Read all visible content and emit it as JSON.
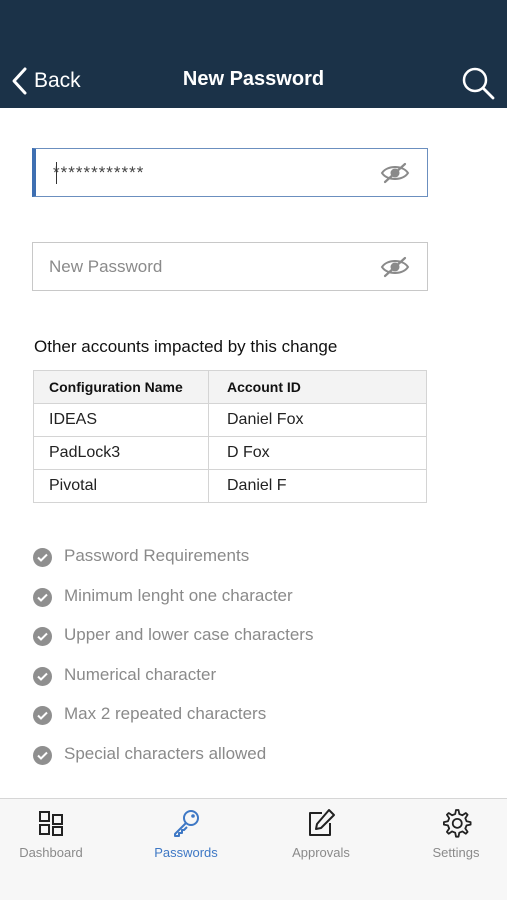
{
  "header": {
    "back_label": "Back",
    "title": "New Password",
    "back_icon": "chevron-left-icon",
    "search_icon": "search-icon"
  },
  "current_password": {
    "value": "************",
    "toggle_icon": "eye-off-icon"
  },
  "new_password": {
    "value": "",
    "placeholder": "New Password",
    "toggle_icon": "eye-off-icon"
  },
  "impacted": {
    "title": "Other accounts impacted by this change",
    "columns": [
      "Configuration Name",
      "Account ID"
    ],
    "rows": [
      [
        "IDEAS",
        "Daniel Fox"
      ],
      [
        "PadLock3",
        "D Fox"
      ],
      [
        "Pivotal",
        "Daniel F"
      ]
    ]
  },
  "requirements": [
    "Password Requirements",
    "Minimum lenght one character",
    "Upper and lower case characters",
    "Numerical character",
    "Max 2 repeated characters",
    "Special characters allowed"
  ],
  "tabbar": {
    "active": "Passwords",
    "tabs": [
      {
        "label": "Dashboard",
        "icon": "dashboard-icon"
      },
      {
        "label": "Passwords",
        "icon": "key-icon"
      },
      {
        "label": "Approvals",
        "icon": "edit-icon"
      },
      {
        "label": "Settings",
        "icon": "gear-icon"
      }
    ]
  },
  "colors": {
    "header_bg": "#1b3248",
    "accent": "#3e78c5",
    "check": "#8f8f8f"
  }
}
